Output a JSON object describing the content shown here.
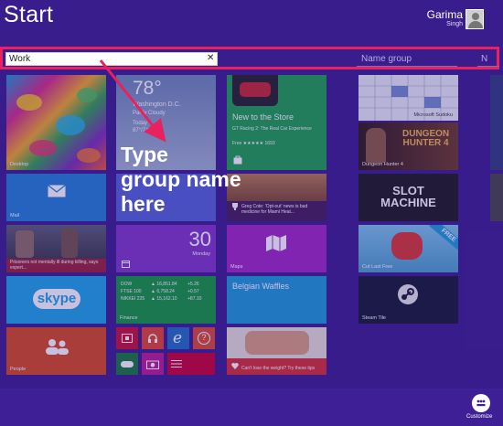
{
  "header": {
    "title": "Start",
    "user_first": "Garima",
    "user_last": "Singh"
  },
  "group_names": {
    "input_value": "Work",
    "clear_label": "✕",
    "placeholder_2": "Name group",
    "placeholder_3": "N"
  },
  "tiles": {
    "butterflies": {
      "label": "Desktop"
    },
    "weather": {
      "temp": "78°",
      "city": "Washington D.C.",
      "cond": "Partly Cloudy",
      "today": "Today",
      "range": "87°/74°"
    },
    "store": {
      "title": "New to the Store",
      "sub": "GT Racing 2: The Real Car Experience",
      "rating": "Free ★★★★★ 1693"
    },
    "sudoku": {
      "label": "Microsoft Sudoku"
    },
    "mail": {
      "label": "Mail"
    },
    "news": {
      "text": "Greg Cote: 'Opt-out' news is bad medicine for Miami Heat..."
    },
    "dungeon": {
      "label": "Dungeon Hunter 4",
      "logo_line1": "DUNGEON",
      "logo_line2": "HUNTER 4"
    },
    "photos": {
      "text": "Prisoners not mentally ill during killing, says expert..."
    },
    "calendar": {
      "day": "30",
      "weekday": "Monday"
    },
    "maps": {
      "label": "Maps"
    },
    "slot": {
      "line1": "SLOT",
      "line2": "MACHINE"
    },
    "cutrope": {
      "label": "Cut Last Free",
      "ribbon": "FREE"
    },
    "skype": {
      "label": "skype"
    },
    "finance": {
      "label": "Finance",
      "rows": [
        [
          "DOW",
          "▲ 16,851.84",
          "+5.26"
        ],
        [
          "FTSE 100",
          "▲ 6,758.24",
          "+0.57"
        ],
        [
          "NIKKEI 225",
          "▲ 15,162.10",
          "+87.10"
        ]
      ]
    },
    "belgian": {
      "label": "Belgian Waffles"
    },
    "steam": {
      "label": "Steam Tile"
    },
    "people": {
      "label": "People"
    },
    "health": {
      "text": "Can't lose the weight? Try these tips"
    }
  },
  "annotation": {
    "line1": "Type",
    "line2": "group name",
    "line3": "here"
  },
  "bottom": {
    "customize": "Customize"
  },
  "colors": {
    "background": "#3a1d8c",
    "highlight": "#e8215f",
    "mail": "#1f7fd1",
    "store": "#18a24a",
    "maps": "#9b27c0",
    "finance": "#0f9a3a",
    "people": "#d44a1b"
  }
}
